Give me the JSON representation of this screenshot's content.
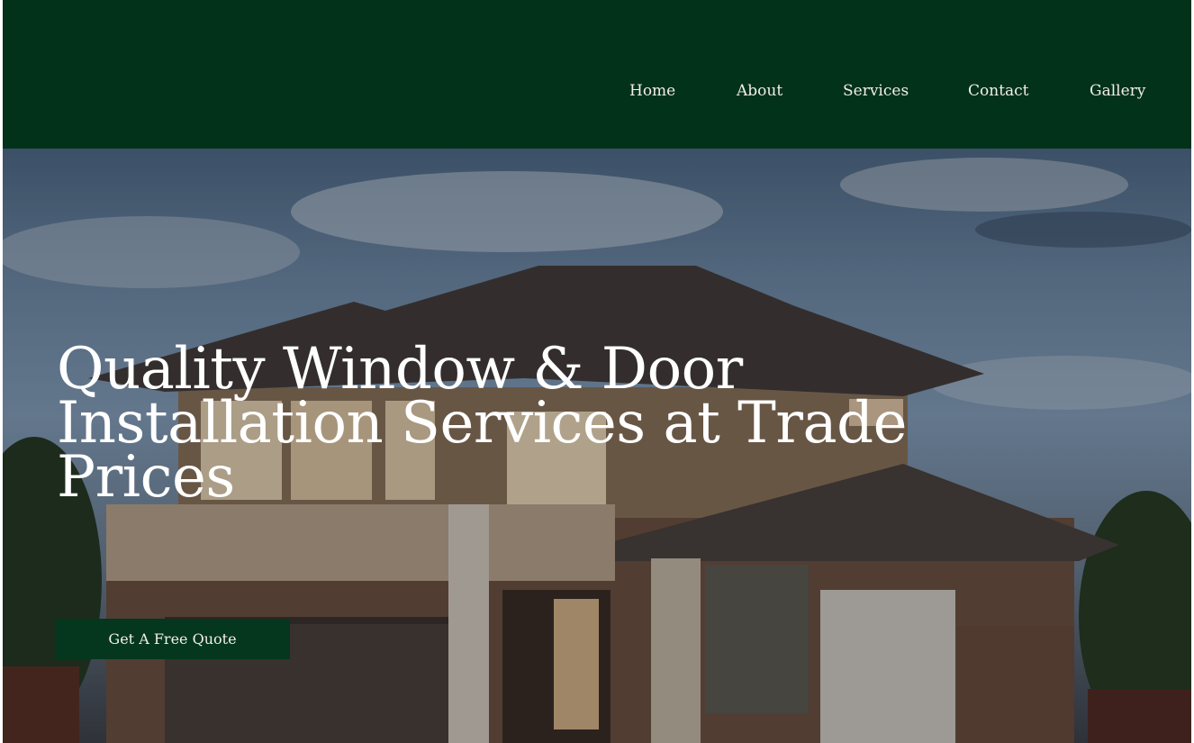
{
  "nav": {
    "items": [
      "Home",
      "About",
      "Services",
      "Contact",
      "Gallery"
    ]
  },
  "hero": {
    "title_lines": [
      "Quality Window & Door",
      "Installation Services at Trade",
      "Prices"
    ],
    "cta_label": "Get A Free Quote",
    "image": "two-story-brick-house-at-dusk"
  },
  "colors": {
    "header_bg": "#03321a",
    "cta_bg": "#04371d",
    "nav_text": "#f1efe8",
    "hero_text": "#ffffff"
  }
}
